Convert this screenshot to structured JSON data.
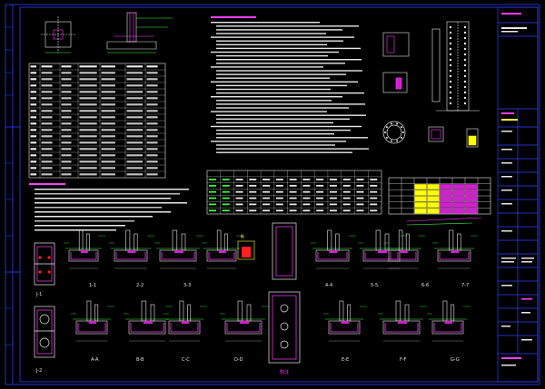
{
  "colors": {
    "background": "#000000",
    "frame": "#2f3fff",
    "line_white": "#e8e8e8",
    "line_green": "#38ff38",
    "line_magenta": "#ff3fff",
    "line_yellow": "#ffff40",
    "line_red": "#ff2020",
    "line_cyan": "#40ffff",
    "fill_magenta": "#d020d0",
    "fill_yellow": "#ffff00"
  },
  "sheet": {
    "type": "structural CAD drawing sheet (foundation / column footing details)",
    "left_table_rows": 18,
    "left_table_cols": 7,
    "mid_table_rows": 7,
    "mid_table_cols": 13,
    "right_table_rows": 6,
    "right_table_cols": 8,
    "section_views_row1": 10,
    "section_views_row2": 9
  },
  "labels": {
    "red_tag": "板",
    "sect_1_1": "1-1",
    "sect_2_2": "2-2",
    "sect_3_3": "3-3",
    "sect_4_4": "4-4",
    "sect_5_5": "5-5",
    "sect_6_6": "6-6",
    "sect_7_7": "7-7",
    "sect_8_8": "8-8",
    "sect_9_9": "9-9",
    "sect_a": "A-A",
    "sect_b": "B-B",
    "sect_c": "C-C",
    "sect_d": "D-D",
    "sect_e": "E-E",
    "sect_f": "F-F",
    "sect_g": "G-G",
    "pile_top": "J-1",
    "pile_bottom": "J-2",
    "mid_title": "基础",
    "bottom_tag": "附注"
  }
}
